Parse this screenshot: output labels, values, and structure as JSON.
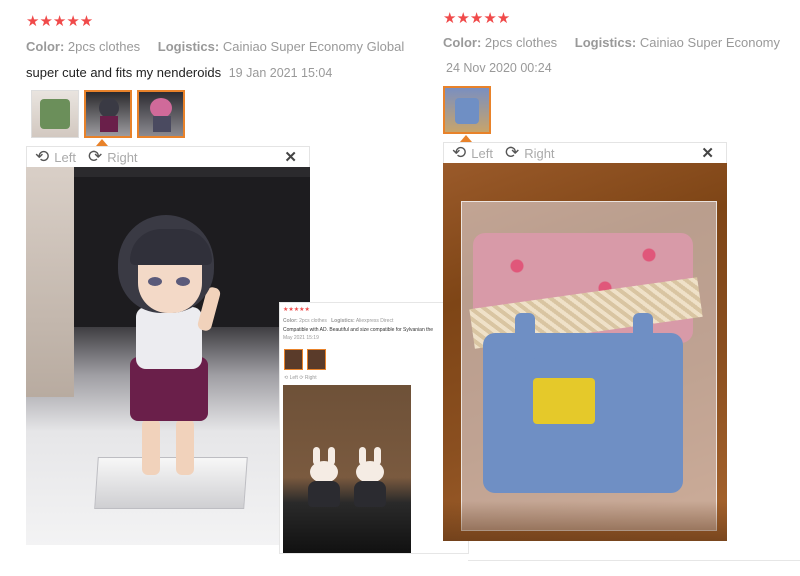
{
  "reviews": [
    {
      "rating_stars": 5,
      "stars": "★★★★★",
      "color_key": "Color:",
      "color_value": "2pcs clothes",
      "logistics_key": "Logistics:",
      "logistics_value": "Cainiao Super Economy Global",
      "comment": "super cute and fits my nenderoids",
      "date": "19 Jan 2021 15:04",
      "toolbar": {
        "rotate_left": "Left",
        "rotate_right": "Right",
        "close": "✕"
      },
      "thumbnail_count": 3,
      "active_thumbnail": 2
    },
    {
      "rating_stars": 5,
      "stars": "★★★★★",
      "color_key": "Color:",
      "color_value": "2pcs clothes",
      "logistics_key": "Logistics:",
      "logistics_value": "Cainiao Super Economy",
      "date": "24 Nov 2020 00:24",
      "toolbar": {
        "rotate_left": "Left",
        "rotate_right": "Right",
        "close": "✕"
      },
      "thumbnail_count": 1,
      "active_thumbnail": 1
    }
  ],
  "inset": {
    "stars": "★★★★★",
    "color_key": "Color:",
    "color_value": "2pcs clothes",
    "logistics_key": "Logistics:",
    "logistics_value": "Aliexpress Direct",
    "comment": "Compatible with AD. Beautiful and size compatible for Sylvanian the",
    "date": "May 2021 15:19",
    "toolbar": {
      "rotate_left": "Left",
      "rotate_right": "Right"
    }
  },
  "colors": {
    "star": "#f04a4a",
    "accent": "#e8822a"
  },
  "icons": {
    "rotate_left": "rotate-left-icon",
    "rotate_right": "rotate-right-icon",
    "close": "close-icon"
  }
}
